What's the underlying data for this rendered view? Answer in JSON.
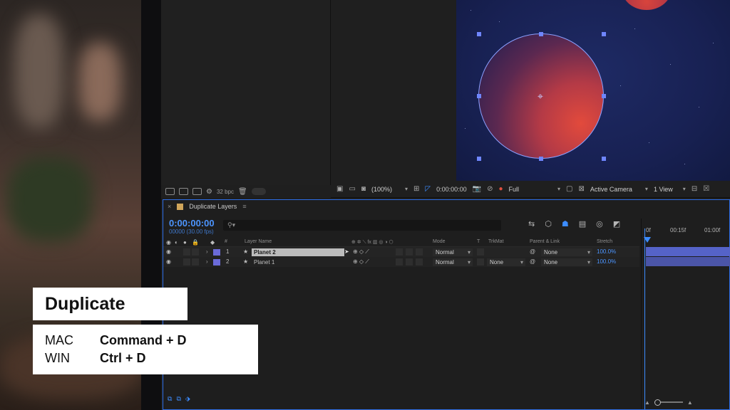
{
  "project": {
    "bpc": "32 bpc"
  },
  "viewer": {
    "zoom": "(100%)",
    "timecode": "0:00:00:00",
    "resolution": "Full",
    "camera": "Active Camera",
    "views": "1 View"
  },
  "timeline": {
    "comp_name": "Duplicate Layers",
    "timecode": "0:00:00:00",
    "frames_fps": "00000 (30.00 fps)",
    "search_icon": "search-icon",
    "columns": {
      "num": "#",
      "layer_name": "Layer Name",
      "mode": "Mode",
      "t": "T",
      "trkmat": "TrkMat",
      "parent": "Parent & Link",
      "stretch": "Stretch"
    },
    "layers": [
      {
        "num": "1",
        "name": "Planet 2",
        "mode": "Normal",
        "trkmat": "",
        "parent": "None",
        "stretch": "100.0%"
      },
      {
        "num": "2",
        "name": "Planet 1",
        "mode": "Normal",
        "trkmat": "None",
        "parent": "None",
        "stretch": "100.0%"
      }
    ],
    "ruler": [
      "0f",
      "00:15f",
      "01:00f"
    ]
  },
  "callout": {
    "title": "Duplicate",
    "mac_label": "MAC",
    "mac_keys": "Command + D",
    "win_label": "WIN",
    "win_keys": "Ctrl + D"
  },
  "colors": {
    "accent": "#3c8cff",
    "layer_label": "#6b6bd9",
    "comp_swatch": "#d0a55a"
  }
}
